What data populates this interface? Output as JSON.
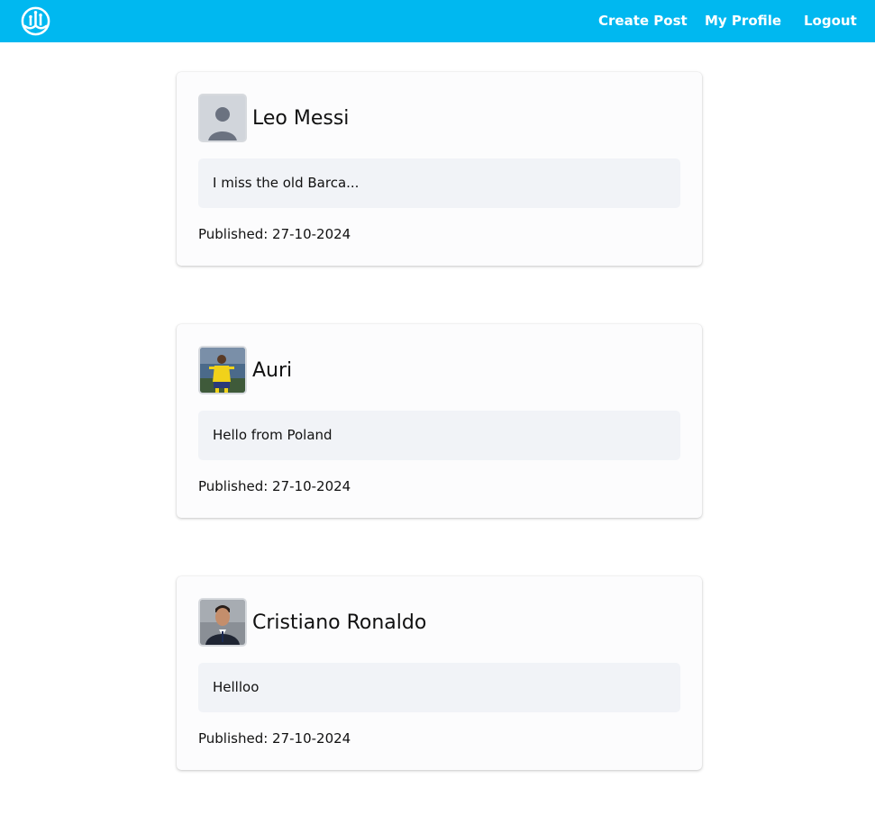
{
  "navbar": {
    "logo": "app-logo",
    "links": [
      {
        "label": "Create Post"
      },
      {
        "label": "My Profile"
      },
      {
        "label": "Logout"
      }
    ]
  },
  "posts": [
    {
      "author": "Leo Messi",
      "avatar": "default-user-avatar",
      "content": "I miss the old Barca...",
      "published": "Published: 27-10-2024"
    },
    {
      "author": "Auri",
      "avatar": "footballer-yellow-kit-photo",
      "content": "Hello from Poland",
      "published": "Published: 27-10-2024"
    },
    {
      "author": "Cristiano Ronaldo",
      "avatar": "man-in-suit-photo",
      "content": "Hellloo",
      "published": "Published: 27-10-2024"
    }
  ],
  "colors": {
    "navbar": "#00b8f0",
    "card": "#fcfcfd",
    "content_box": "#f1f3f7"
  }
}
